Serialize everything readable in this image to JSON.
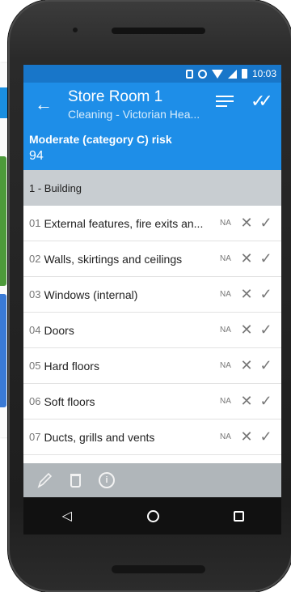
{
  "status_bar": {
    "time": "10:03",
    "icons": [
      "vibrate-icon",
      "alarm-icon",
      "wifi-icon",
      "signal-icon",
      "battery-icon"
    ]
  },
  "app_bar": {
    "title": "Store Room 1",
    "subtitle": "Cleaning - Victorian Hea...",
    "back_icon": "←",
    "done_icon": "✓✓"
  },
  "risk": {
    "label": "Moderate (category C) risk",
    "score": "94"
  },
  "section": {
    "title": "1 - Building"
  },
  "items": [
    {
      "num": "01",
      "label": "External features, fire exits an...",
      "na": "NA",
      "x": "✕",
      "tick": "✓"
    },
    {
      "num": "02",
      "label": "Walls, skirtings and ceilings",
      "na": "NA",
      "x": "✕",
      "tick": "✓"
    },
    {
      "num": "03",
      "label": "Windows (internal)",
      "na": "NA",
      "x": "✕",
      "tick": "✓"
    },
    {
      "num": "04",
      "label": "Doors",
      "na": "NA",
      "x": "✕",
      "tick": "✓"
    },
    {
      "num": "05",
      "label": "Hard floors",
      "na": "NA",
      "x": "✕",
      "tick": "✓"
    },
    {
      "num": "06",
      "label": "Soft floors",
      "na": "NA",
      "x": "✕",
      "tick": "✓"
    },
    {
      "num": "07",
      "label": "Ducts, grills and vents",
      "na": "NA",
      "x": "✕",
      "tick": "✓"
    }
  ],
  "bottom_bar": {
    "icons": [
      "pencil-icon",
      "trash-icon",
      "info-icon"
    ],
    "info_glyph": "i"
  },
  "nav_bar": {
    "back_glyph": "◁"
  },
  "colors": {
    "status_bar": "#1876c9",
    "app_bar": "#1e8ee8",
    "section_header": "#c8cdd1",
    "bottom_bar": "#b0b6ba"
  }
}
